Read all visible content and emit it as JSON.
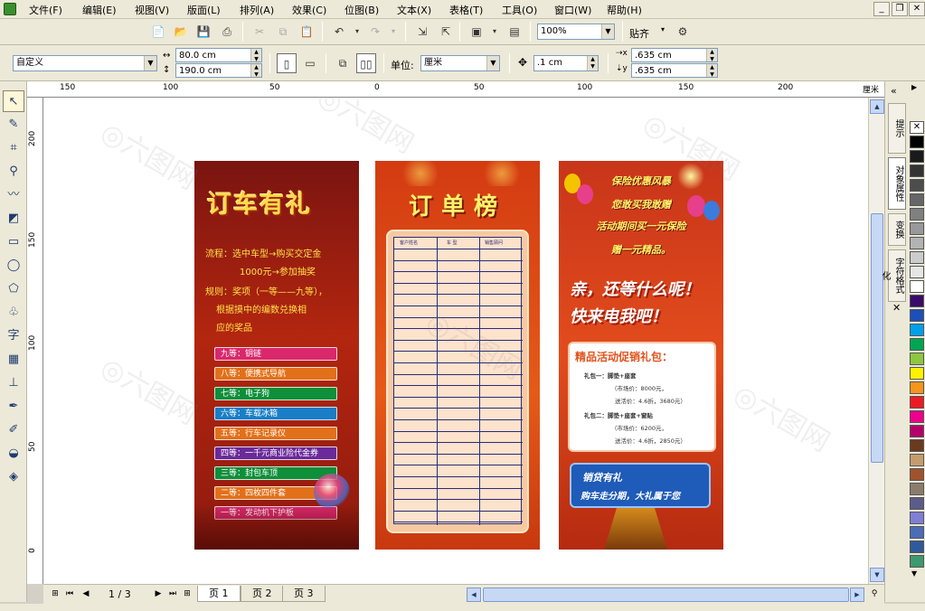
{
  "menu": {
    "items": [
      "文件(F)",
      "编辑(E)",
      "视图(V)",
      "版面(L)",
      "排列(A)",
      "效果(C)",
      "位图(B)",
      "文本(X)",
      "表格(T)",
      "工具(O)",
      "窗口(W)",
      "帮助(H)"
    ]
  },
  "toolbar": {
    "zoom": "100%",
    "snap_label": "贴齐"
  },
  "propbar": {
    "page_preset": "自定义",
    "width": "80.0 cm",
    "height": "190.0 cm",
    "unit_label": "单位:",
    "unit": "厘米",
    "nudge": ".1 cm",
    "dup_x": ".635 cm",
    "dup_y": ".635 cm"
  },
  "ruler": {
    "h_labels": [
      "150",
      "100",
      "50",
      "0",
      "50",
      "100",
      "150",
      "200"
    ],
    "v_labels": [
      "200",
      "150",
      "100",
      "50",
      "0"
    ],
    "unit": "厘米"
  },
  "pagebar": {
    "page_counter": "1 / 3",
    "tabs": [
      "页 1",
      "页 2",
      "页 3"
    ]
  },
  "docker": {
    "tabs": [
      "提示",
      "对象属性",
      "变换",
      "字符格式化"
    ]
  },
  "palette": {
    "colors": [
      "#000000",
      "#1a1a1a",
      "#333333",
      "#4d4d4d",
      "#666666",
      "#808080",
      "#999999",
      "#b3b3b3",
      "#cccccc",
      "#e6e6e6",
      "#ffffff",
      "#3a0b6b",
      "#1d4fb8",
      "#00a0e9",
      "#00a651",
      "#8dc63f",
      "#fff200",
      "#f7941d",
      "#ed1c24",
      "#ec008c",
      "#b5006b",
      "#6b3a1e",
      "#c69c6d",
      "#a0522d",
      "#8b7d6b",
      "#5c5c8a",
      "#7f7fd5",
      "#4b6cb7",
      "#2f5a9a",
      "#3d9970"
    ]
  },
  "panel1": {
    "title": "订车有礼",
    "flow_line1": "流程：选中车型→购买交定金",
    "flow_line2": "1000元→参加抽奖",
    "rule_line1": "规则：奖项（一等——九等），",
    "rule_line2": "根据摸中的编数兑换相",
    "rule_line3": "应的奖品",
    "prizes": [
      {
        "label": "九等：钥链",
        "color": "#d9286c"
      },
      {
        "label": "八等：便携式导航",
        "color": "#e2701a"
      },
      {
        "label": "七等：电子狗",
        "color": "#0f8f3a"
      },
      {
        "label": "六等：车载冰箱",
        "color": "#1a7ec7"
      },
      {
        "label": "五等：行车记录仪",
        "color": "#e2701a"
      },
      {
        "label": "四等：一千元商业险代金券",
        "color": "#6a2a9a"
      },
      {
        "label": "三等：封包车顶",
        "color": "#0f8f3a"
      },
      {
        "label": "二等：四枚四件套",
        "color": "#e2701a"
      },
      {
        "label": "一等：发动机下护板",
        "color": "#d9286c"
      }
    ]
  },
  "panel2": {
    "title": "订单榜",
    "headers": [
      "客户姓名",
      "车 型",
      "销售顾问"
    ]
  },
  "panel3": {
    "line1": "保险优惠风暴",
    "line2": "您敢买我敢赠",
    "line3": "活动期间买一元保险",
    "line4": "赠一元精品。",
    "big1": "亲，还等什么呢！",
    "big2": "快来电我吧！",
    "gift_title": "精品活动促销礼包：",
    "gift_lines": [
      "礼包一：脚垫+座套",
      "（市场价：8000元，",
      "送活价：4.6折，3680元）",
      "礼包二：脚垫+座套+窗贴",
      "（市场价：6200元，",
      "送活价：4.6折，2850元）"
    ],
    "loan1": "销贷有礼",
    "loan2": "购车走分期，大礼属于您"
  }
}
